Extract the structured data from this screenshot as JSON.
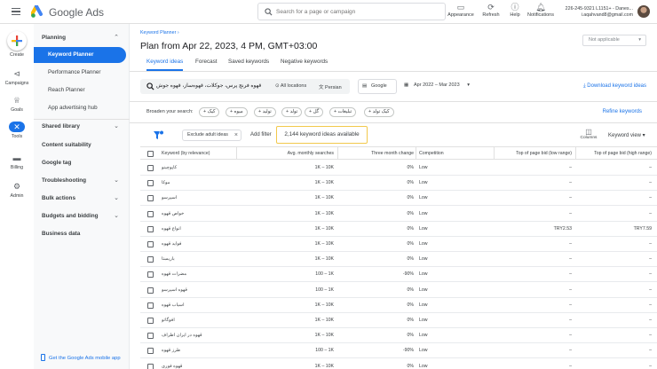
{
  "topbar": {
    "brand": "Google Ads",
    "search_placeholder": "Search for a page or campaign",
    "buttons": [
      {
        "label": "Appearance",
        "icon": "appearance-icon"
      },
      {
        "label": "Refresh",
        "icon": "refresh-icon"
      },
      {
        "label": "Help",
        "icon": "help-icon"
      },
      {
        "label": "Notifications",
        "icon": "bell-icon"
      }
    ],
    "account_id": "226-245-9321 L1151+ - Danes...",
    "account_email": "i.aqahvand8@gmail.com"
  },
  "rail": [
    {
      "label": "Create",
      "icon": "plus-icon"
    },
    {
      "label": "Campaigns",
      "icon": "megaphone-icon"
    },
    {
      "label": "Goals",
      "icon": "trophy-icon"
    },
    {
      "label": "Tools",
      "icon": "tools-icon",
      "active": true
    },
    {
      "label": "Billing",
      "icon": "credit-card-icon"
    },
    {
      "label": "Admin",
      "icon": "gear-icon"
    }
  ],
  "sidenav": {
    "planning": "Planning",
    "planning_items": [
      "Keyword Planner",
      "Performance Planner",
      "Reach Planner",
      "App advertising hub"
    ],
    "groups": [
      {
        "label": "Shared library",
        "expandable": true
      },
      {
        "label": "Content suitability",
        "expandable": false
      },
      {
        "label": "Google tag",
        "expandable": false
      },
      {
        "label": "Troubleshooting",
        "expandable": true
      },
      {
        "label": "Bulk actions",
        "expandable": true
      },
      {
        "label": "Budgets and bidding",
        "expandable": true
      },
      {
        "label": "Business data",
        "expandable": false
      }
    ],
    "mobile_link": "Get the Google Ads mobile app"
  },
  "main": {
    "breadcrumb": "Keyword Planner",
    "title": "Plan from Apr 22, 2023, 4 PM, GMT+03:00",
    "not_applicable": "Not applicable",
    "tabs": [
      "Keyword ideas",
      "Forecast",
      "Saved keywords",
      "Negative keywords"
    ],
    "search_keywords": "قهوه فرنچ پرس، جوکلات، قهوه‌ساز، قهوه جوش",
    "location": "All locations",
    "language": "Persian",
    "network": "Google",
    "date_range": "Apr 2022 – Mar 2023",
    "download": "Download keyword ideas",
    "broaden_label": "Broaden your search:",
    "chips": [
      "کیک",
      "میوه",
      "تولید",
      "تولد",
      "گل",
      "تبلیغات",
      "کیک تولد"
    ],
    "refine": "Refine keywords",
    "exclude_adult": "Exclude adult ideas",
    "add_filter": "Add filter",
    "available": "2,144 keyword ideas available",
    "columns": "Columns",
    "keyword_view": "Keyword view"
  },
  "table": {
    "headers": [
      "Keyword (by relevance)",
      "Avg. monthly searches",
      "Three month change",
      "Competition",
      "Top of page bid (low range)",
      "Top of page bid (high range)"
    ],
    "rows": [
      {
        "keyword": "کاپوچینو",
        "searches": "1K – 10K",
        "change": "0%",
        "competition": "Low",
        "low": "–",
        "high": "–"
      },
      {
        "keyword": "موکا",
        "searches": "1K – 10K",
        "change": "0%",
        "competition": "Low",
        "low": "–",
        "high": "–"
      },
      {
        "keyword": "اسپرسو",
        "searches": "1K – 10K",
        "change": "0%",
        "competition": "Low",
        "low": "–",
        "high": "–"
      },
      {
        "keyword": "خواص قهوه",
        "searches": "1K – 10K",
        "change": "0%",
        "competition": "Low",
        "low": "–",
        "high": "–"
      },
      {
        "keyword": "انواع قهوه",
        "searches": "1K – 10K",
        "change": "0%",
        "competition": "Low",
        "low": "TRY2.53",
        "high": "TRY7.59"
      },
      {
        "keyword": "فواید قهوه",
        "searches": "1K – 10K",
        "change": "0%",
        "competition": "Low",
        "low": "–",
        "high": "–"
      },
      {
        "keyword": "باریستا",
        "searches": "1K – 10K",
        "change": "0%",
        "competition": "Low",
        "low": "–",
        "high": "–"
      },
      {
        "keyword": "مضرات قهوه",
        "searches": "100 – 1K",
        "change": "-90%",
        "competition": "Low",
        "low": "–",
        "high": "–"
      },
      {
        "keyword": "قهوه اسپرسو",
        "searches": "100 – 1K",
        "change": "0%",
        "competition": "Low",
        "low": "–",
        "high": "–"
      },
      {
        "keyword": "اسیاب قهوه",
        "searches": "1K – 10K",
        "change": "0%",
        "competition": "Low",
        "low": "–",
        "high": "–"
      },
      {
        "keyword": "افوگاتو",
        "searches": "1K – 10K",
        "change": "0%",
        "competition": "Low",
        "low": "–",
        "high": "–"
      },
      {
        "keyword": "قهوه در ایران اطراف",
        "searches": "1K – 10K",
        "change": "0%",
        "competition": "Low",
        "low": "–",
        "high": "–"
      },
      {
        "keyword": "طرز قهوه",
        "searches": "100 – 1K",
        "change": "-90%",
        "competition": "Low",
        "low": "–",
        "high": "–"
      },
      {
        "keyword": "قهوه فوری",
        "searches": "1K – 10K",
        "change": "0%",
        "competition": "Low",
        "low": "–",
        "high": "–"
      }
    ]
  }
}
